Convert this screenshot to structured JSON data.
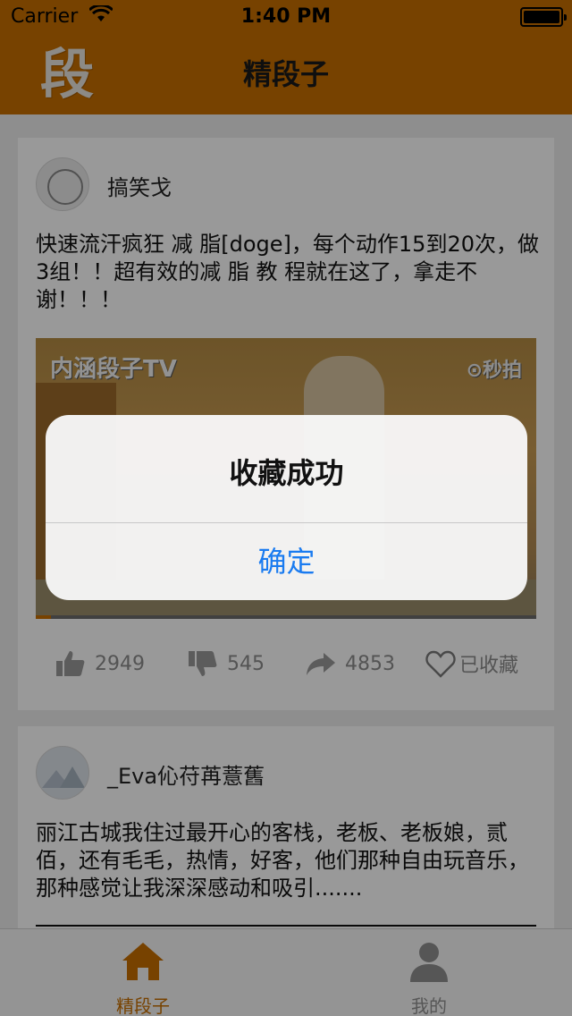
{
  "status_bar": {
    "carrier": "Carrier",
    "time": "1:40 PM"
  },
  "nav": {
    "logo_text": "段",
    "title": "精段子"
  },
  "posts": [
    {
      "username": "搞笑戈",
      "text": "快速流汗疯狂 减 脂[doge]，每个动作15到20次，做3组！！超有效的减 脂 教 程就在这了，拿走不谢！！！",
      "video": {
        "watermark_left": "内涵段子TV",
        "watermark_right": "⊙秒拍",
        "progress": 0.03
      },
      "actions": {
        "likes": "2949",
        "dislikes": "545",
        "shares": "4853",
        "favorite_label": "已收藏"
      }
    },
    {
      "username": "_Eva伈苻苒薏舊",
      "text": "丽江古城我住过最开心的客栈，老板、老板娘，贰佰，还有毛毛，热情，好客，他们那种自由玩音乐，那种感觉让我深深感动和吸引......."
    }
  ],
  "tabbar": {
    "tabs": [
      {
        "label": "精段子"
      },
      {
        "label": "我的"
      }
    ]
  },
  "alert": {
    "title": "收藏成功",
    "button": "确定"
  },
  "colors": {
    "accent": "#c76e00",
    "alert_button": "#1a7bf0"
  }
}
